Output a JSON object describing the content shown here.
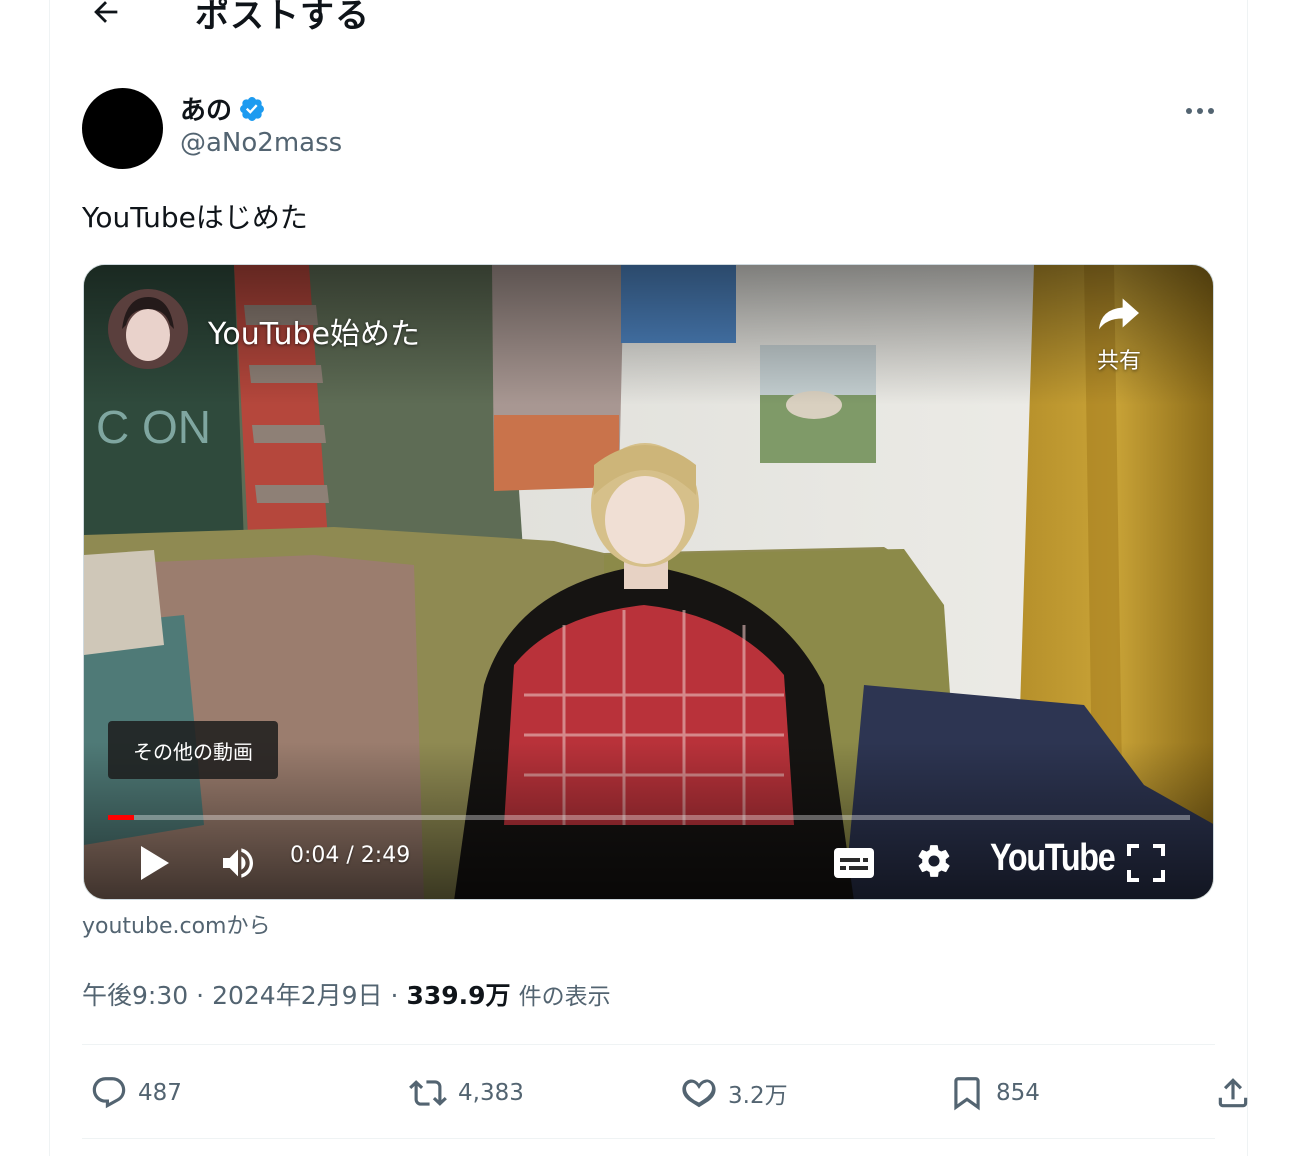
{
  "header": {
    "title": "ポストする"
  },
  "author": {
    "name": "あの",
    "handle": "@aNo2mass",
    "verified": true
  },
  "post": {
    "text": "YouTubeはじめた"
  },
  "video": {
    "title": "YouTube始めた",
    "share_label": "共有",
    "more_videos_label": "その他の動画",
    "time": "0:04 / 2:49",
    "progress": 0.024,
    "logo_text": "YouTube",
    "source": "youtube.comから"
  },
  "meta": {
    "time": "午後9:30",
    "sep1": "·",
    "date": "2024年2月9日",
    "sep2": "·",
    "views": "339.9万",
    "views_label": "件の表示"
  },
  "actions": {
    "reply_count": "487",
    "repost_count": "4,383",
    "like_count": "3.2万",
    "bookmark_count": "854"
  },
  "colors": {
    "verified": "#1d9bf0",
    "muted": "#536471",
    "progress": "#ff0000"
  }
}
